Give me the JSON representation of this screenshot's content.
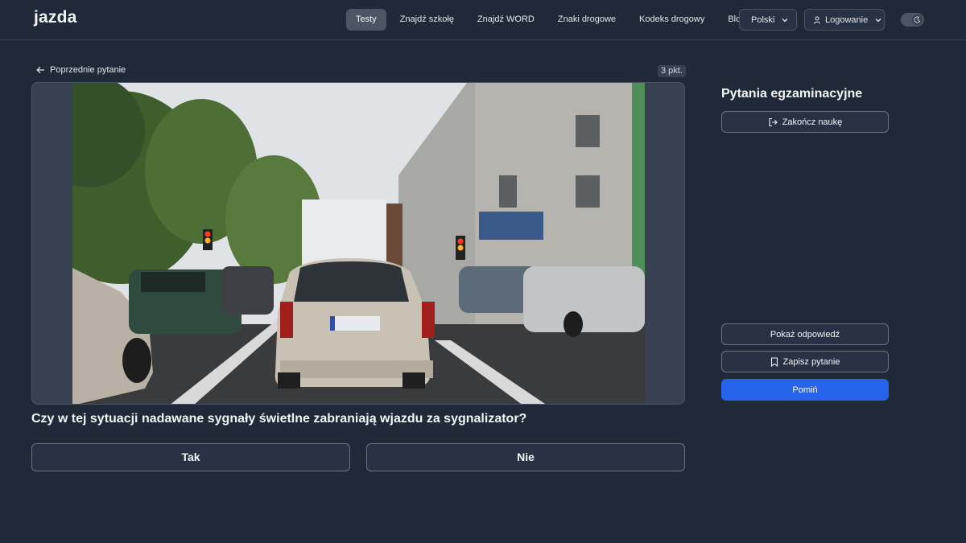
{
  "header": {
    "logo": "jazda",
    "nav": [
      "Testy",
      "Znajdź szkołę",
      "Znajdź WORD",
      "Znaki drogowe",
      "Kodeks drogowy",
      "Blog"
    ],
    "language": "Polski",
    "login": "Logowanie"
  },
  "question": {
    "back_label": "Poprzednie pytanie",
    "points": "3 pkt.",
    "text": "Czy w tej sytuacji nadawane sygnały świetlne zabraniają wjazdu za sygnalizator?",
    "answers": {
      "yes": "Tak",
      "no": "Nie"
    }
  },
  "sidebar": {
    "title": "Pytania egzaminacyjne",
    "finish_label": "Zakończ naukę",
    "show_answer_label": "Pokaż odpowiedź",
    "save_label": "Zapisz pytanie",
    "skip_label": "Pomiń"
  },
  "colors": {
    "background": "#1f2937",
    "accent": "#2563eb",
    "panel": "#374151"
  },
  "icons": [
    "arrow-left-icon",
    "chevron-down-icon",
    "user-icon",
    "moon-icon",
    "logout-icon",
    "bookmark-icon"
  ]
}
